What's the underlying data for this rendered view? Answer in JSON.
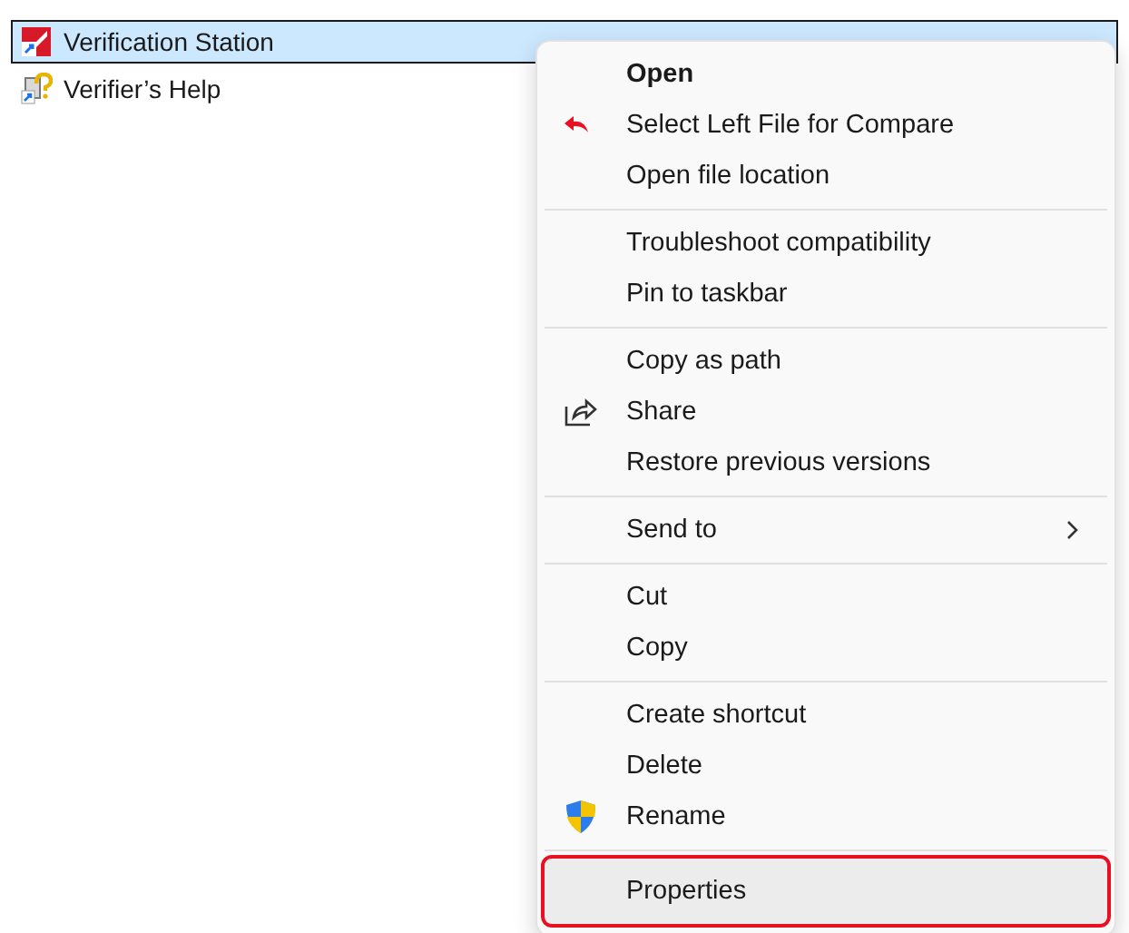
{
  "files": [
    {
      "name": "Verification Station",
      "kind": "app",
      "selected": true
    },
    {
      "name": "Verifier’s Help",
      "kind": "help",
      "selected": false
    }
  ],
  "context_menu": {
    "groups": [
      {
        "items": [
          {
            "label": "Open",
            "kind": "default",
            "highlighted": false
          },
          {
            "label": "Select Left File for Compare",
            "kind": "compare",
            "highlighted": false
          },
          {
            "label": "Open file location",
            "kind": "plain",
            "highlighted": false
          }
        ]
      },
      {
        "items": [
          {
            "label": "Troubleshoot compatibility",
            "kind": "plain",
            "highlighted": false
          },
          {
            "label": "Pin to taskbar",
            "kind": "plain",
            "highlighted": false
          }
        ]
      },
      {
        "items": [
          {
            "label": "Copy as path",
            "kind": "plain",
            "highlighted": false
          },
          {
            "label": "Share",
            "kind": "share",
            "highlighted": false
          },
          {
            "label": "Restore previous versions",
            "kind": "plain",
            "highlighted": false
          }
        ]
      },
      {
        "items": [
          {
            "label": "Send to",
            "kind": "submenu",
            "highlighted": false
          }
        ]
      },
      {
        "items": [
          {
            "label": "Cut",
            "kind": "plain",
            "highlighted": false
          },
          {
            "label": "Copy",
            "kind": "plain",
            "highlighted": false
          }
        ]
      },
      {
        "items": [
          {
            "label": "Create shortcut",
            "kind": "plain",
            "highlighted": false
          },
          {
            "label": "Delete",
            "kind": "plain",
            "highlighted": false
          },
          {
            "label": "Rename",
            "kind": "shield",
            "highlighted": false
          }
        ]
      },
      {
        "items": [
          {
            "label": "Properties",
            "kind": "plain",
            "highlighted": true
          }
        ]
      }
    ]
  }
}
